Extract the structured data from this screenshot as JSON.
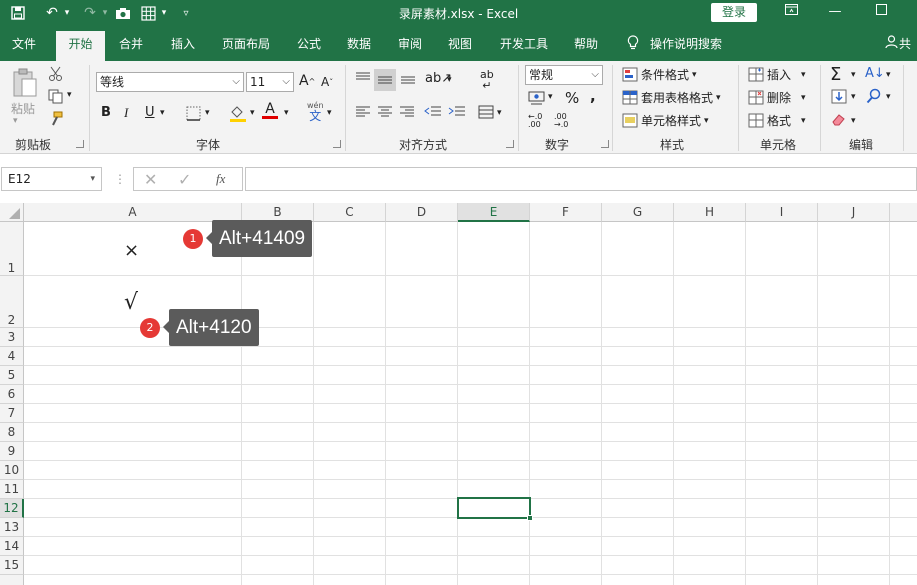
{
  "titlebar": {
    "title": "录屏素材.xlsx  -  Excel",
    "login": "登录",
    "icons": [
      "save-icon",
      "undo-icon",
      "redo-icon",
      "camera-icon",
      "grid-icon",
      "customize-icon"
    ]
  },
  "tabs": [
    "文件",
    "开始",
    "合并",
    "插入",
    "页面布局",
    "公式",
    "数据",
    "审阅",
    "视图",
    "开发工具",
    "帮助"
  ],
  "tell_me": "操作说明搜索",
  "share": "共",
  "ribbon": {
    "clipboard": {
      "label": "剪贴板",
      "paste": "粘贴"
    },
    "font": {
      "label": "字体",
      "font_name": "等线",
      "font_size": "11",
      "bold": "B",
      "italic": "I",
      "underline": "U",
      "grow": "A",
      "shrink": "A",
      "color_a": "A",
      "wen": "wén",
      "wen_char": "文"
    },
    "alignment": {
      "label": "对齐方式",
      "wrap": "ab"
    },
    "number": {
      "label": "数字",
      "format": "常规",
      "percent": "%",
      "comma": ","
    },
    "styles": {
      "label": "样式",
      "conditional": "条件格式",
      "table": "套用表格格式",
      "cell_styles": "单元格样式"
    },
    "cells": {
      "label": "单元格",
      "insert": "插入",
      "delete": "删除",
      "format": "格式"
    },
    "editing": {
      "label": "编辑"
    }
  },
  "formula_bar": {
    "name_box": "E12",
    "formula": ""
  },
  "columns": [
    "A",
    "B",
    "C",
    "D",
    "E",
    "F",
    "G",
    "H",
    "I",
    "J"
  ],
  "rows": [
    "1",
    "2",
    "3",
    "4",
    "5",
    "6",
    "7",
    "8",
    "9",
    "10",
    "11",
    "12",
    "13",
    "14",
    "15"
  ],
  "cells": {
    "A1": "×",
    "A2": "√"
  },
  "annotations": [
    {
      "badge": "1",
      "text": "Alt+41409"
    },
    {
      "badge": "2",
      "text": "Alt+4120"
    }
  ],
  "colors": {
    "accent": "#217346",
    "badge": "#e53935",
    "tooltip": "#5b5b5b"
  }
}
